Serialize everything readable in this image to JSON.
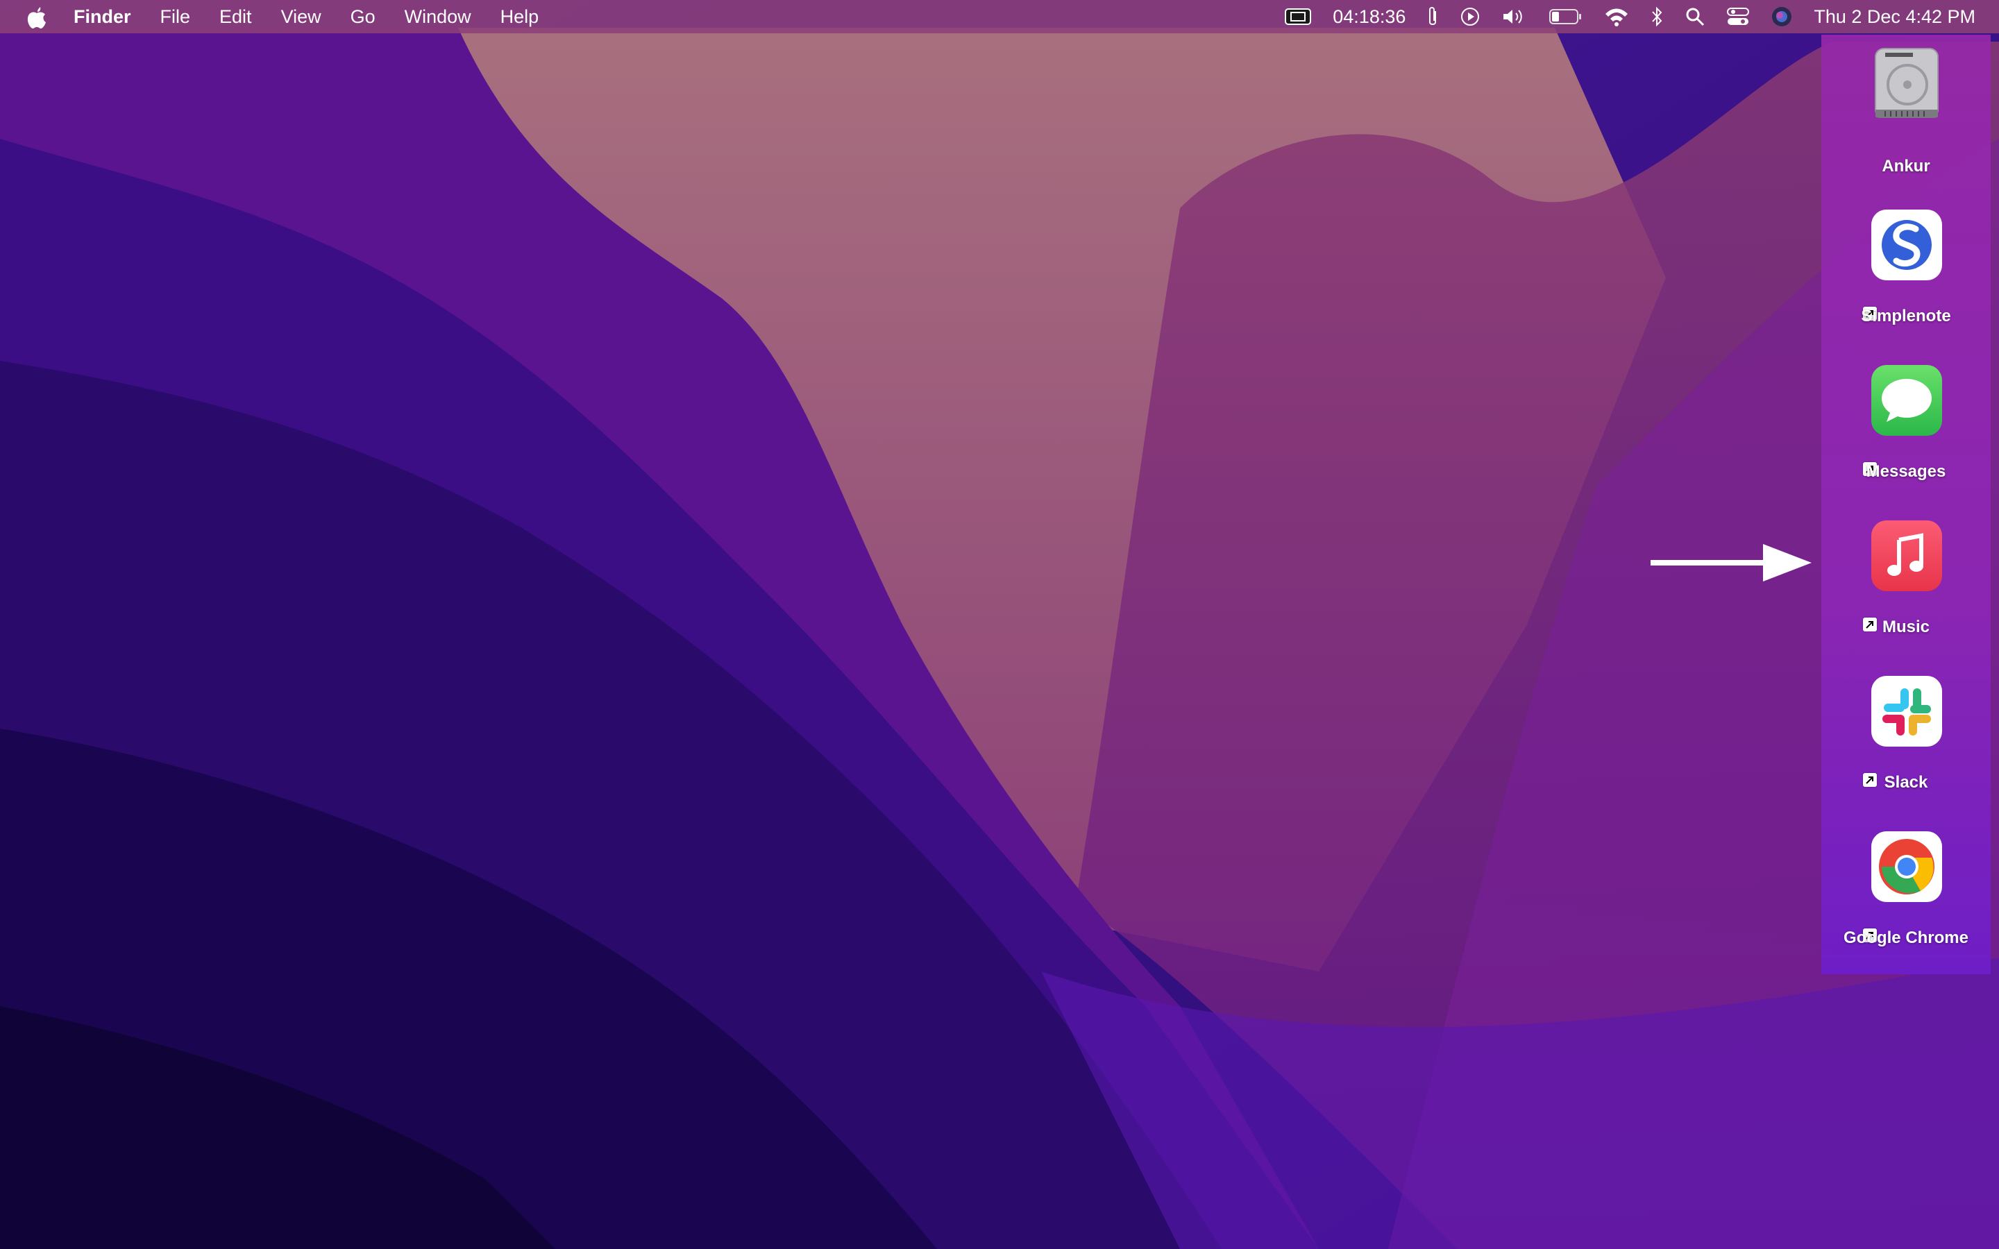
{
  "menubar": {
    "apple_icon": "apple-logo-icon",
    "menus": [
      "Finder",
      "File",
      "Edit",
      "View",
      "Go",
      "Window",
      "Help"
    ],
    "status": {
      "timer": "04:18:36",
      "clock": "Thu 2 Dec  4:42 PM",
      "icons": [
        "display-mirror-icon",
        "paperclip-icon",
        "play-icon",
        "volume-icon",
        "battery-icon",
        "wifi-icon",
        "bluetooth-icon",
        "search-icon",
        "control-center-icon",
        "siri-icon"
      ]
    }
  },
  "stacks": {
    "items": [
      {
        "label": "Ankur",
        "icon": "hard-drive-icon",
        "alias": false
      },
      {
        "label": "Simplenote",
        "icon": "simplenote-icon",
        "alias": true
      },
      {
        "label": "Messages",
        "icon": "messages-icon",
        "alias": true
      },
      {
        "label": "Music",
        "icon": "music-icon",
        "alias": true
      },
      {
        "label": "Slack",
        "icon": "slack-icon",
        "alias": true
      },
      {
        "label": "Google Chrome",
        "icon": "chrome-icon",
        "alias": true
      }
    ]
  },
  "annotation": {
    "arrow_icon": "arrow-right-icon"
  },
  "colors": {
    "menubar": "#8C4078",
    "sidebar": "#9628AA",
    "wallpaper_dark": "#120630",
    "wallpaper_mid": "#4A1490",
    "wallpaper_light": "#9C6478"
  }
}
